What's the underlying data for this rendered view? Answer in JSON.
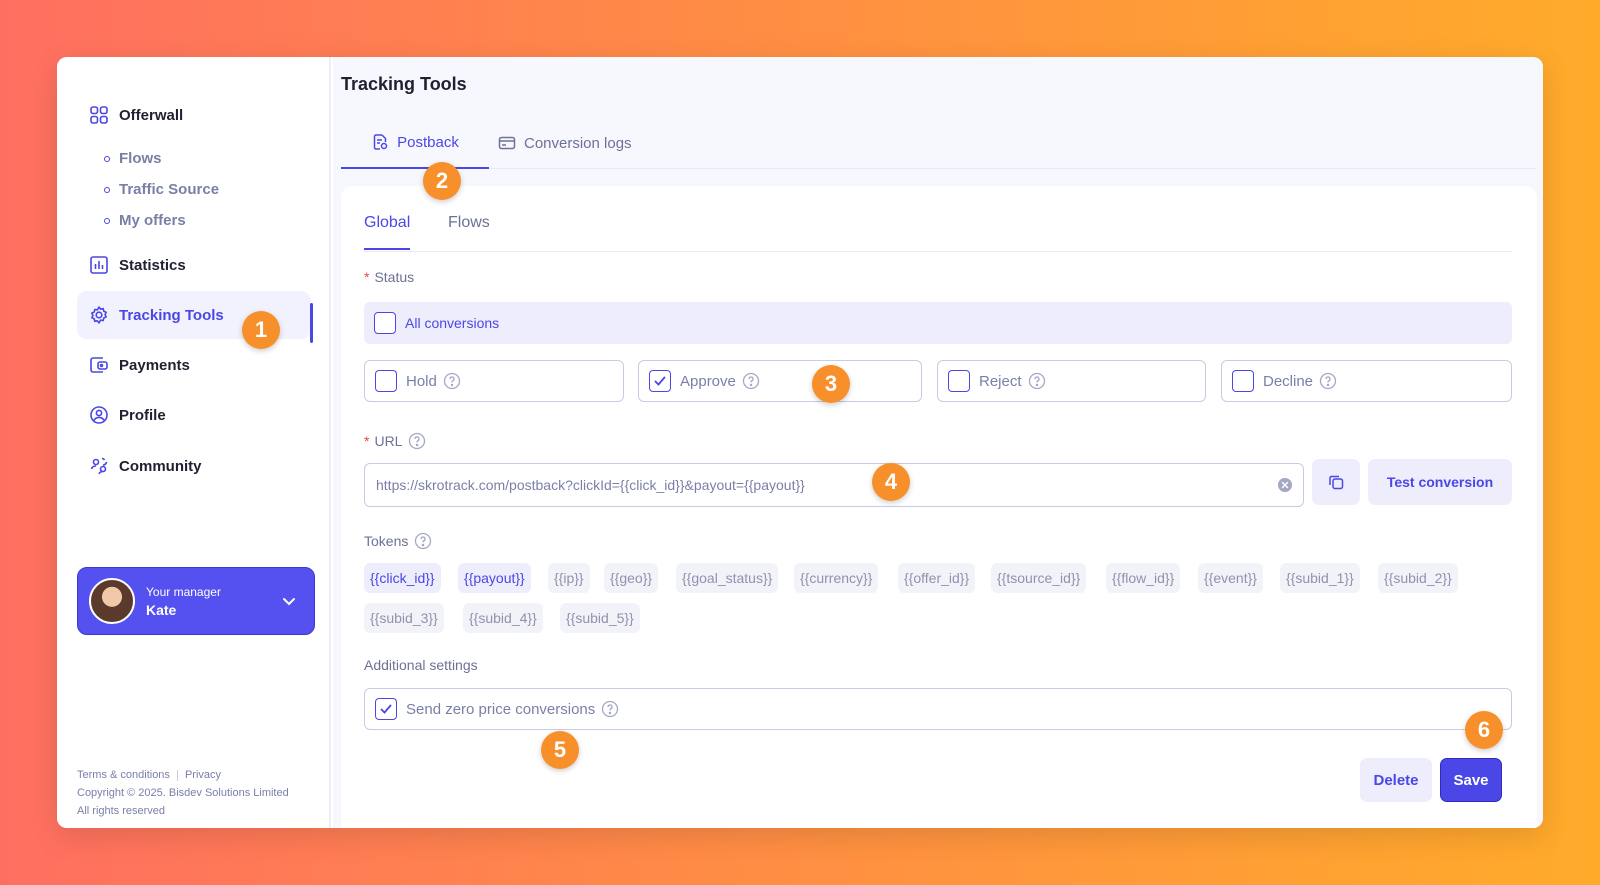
{
  "sidebar": {
    "nav": [
      {
        "label": "Offerwall",
        "icon": "grid-icon"
      },
      {
        "label": "Statistics",
        "icon": "chart-icon"
      },
      {
        "label": "Tracking Tools",
        "icon": "gear-icon"
      },
      {
        "label": "Payments",
        "icon": "wallet-icon"
      },
      {
        "label": "Profile",
        "icon": "user-circle-icon"
      },
      {
        "label": "Community",
        "icon": "community-icon"
      }
    ],
    "sub_items": [
      "Flows",
      "Traffic Source",
      "My offers"
    ],
    "manager": {
      "label": "Your manager",
      "name": "Kate"
    },
    "footer": {
      "terms": "Terms & conditions",
      "privacy": "Privacy",
      "copyright": "Copyright © 2025. Bisdev Solutions Limited",
      "rights": "All rights reserved"
    }
  },
  "main": {
    "title": "Tracking Tools",
    "tabs": [
      {
        "label": "Postback",
        "icon": "document-icon"
      },
      {
        "label": "Conversion logs",
        "icon": "card-icon"
      }
    ],
    "inner_tabs": [
      "Global",
      "Flows"
    ],
    "status": {
      "label": "Status",
      "all_label": "All conversions",
      "options": [
        {
          "label": "Hold",
          "checked": false
        },
        {
          "label": "Approve",
          "checked": true
        },
        {
          "label": "Reject",
          "checked": false
        },
        {
          "label": "Decline",
          "checked": false
        }
      ]
    },
    "url": {
      "label": "URL",
      "value": "https://skrotrack.com/postback?clickId={{click_id}}&payout={{payout}}",
      "test_label": "Test conversion"
    },
    "tokens": {
      "label": "Tokens",
      "items": [
        "{{click_id}}",
        "{{payout}}",
        "{{ip}}",
        "{{geo}}",
        "{{goal_status}}",
        "{{currency}}",
        "{{offer_id}}",
        "{{tsource_id}}",
        "{{flow_id}}",
        "{{event}}",
        "{{subid_1}}",
        "{{subid_2}}",
        "{{subid_3}}",
        "{{subid_4}}",
        "{{subid_5}}"
      ],
      "active": [
        "{{click_id}}",
        "{{payout}}"
      ]
    },
    "additional": {
      "label": "Additional settings",
      "zero_price_label": "Send zero price conversions",
      "zero_price_checked": true
    },
    "actions": {
      "delete": "Delete",
      "save": "Save"
    }
  },
  "badges": [
    "1",
    "2",
    "3",
    "4",
    "5",
    "6"
  ],
  "colors": {
    "accent": "#4b47e6",
    "badge": "#f7902a"
  }
}
